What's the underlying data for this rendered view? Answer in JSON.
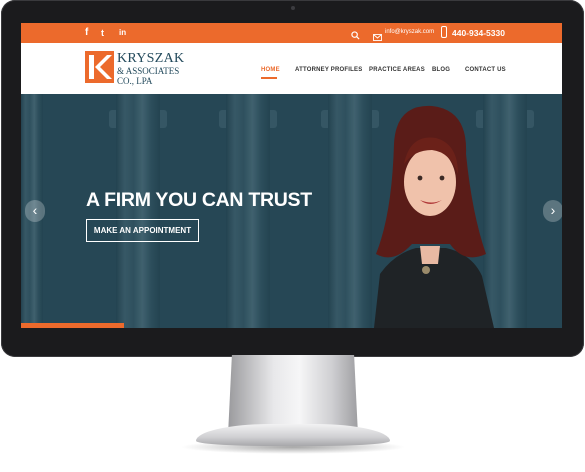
{
  "colors": {
    "accent": "#ec6a2c",
    "hero_overlay": "#2e4f5d",
    "logo_blue": "#234a5c"
  },
  "topbar": {
    "social_icons": [
      "facebook-icon",
      "twitter-icon",
      "linkedin-icon"
    ],
    "social_glyphs": {
      "facebook": "f",
      "twitter": "t",
      "linkedin": "in"
    },
    "email": "info@kryszak.com",
    "phone": "440-934-5330"
  },
  "logo": {
    "line1": "KRYSZAK",
    "line2": "& ASSOCIATES",
    "line3": "CO., LPA"
  },
  "nav": {
    "items": [
      "HOME",
      "ATTORNEY PROFILES",
      "PRACTICE AREAS",
      "BLOG",
      "CONTACT US"
    ],
    "active": "HOME"
  },
  "hero": {
    "title": "A FIRM YOU CAN TRUST",
    "cta_label": "MAKE AN APPOINTMENT",
    "prev_arrow": "‹",
    "next_arrow": "›",
    "slide_progress": 0.19
  }
}
